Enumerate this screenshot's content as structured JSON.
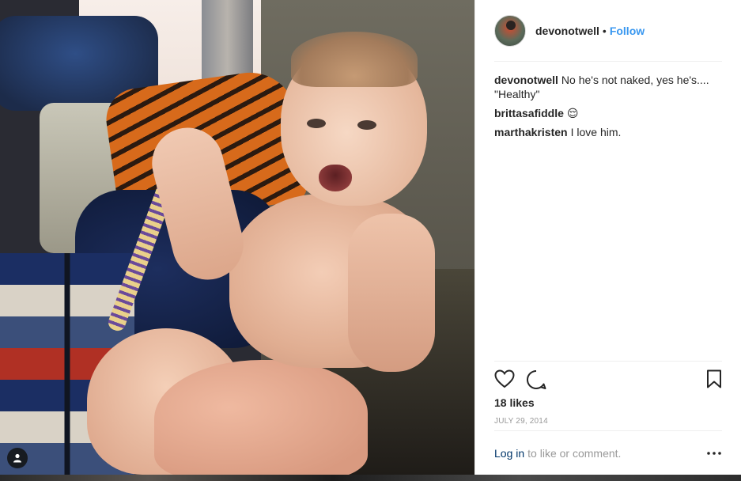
{
  "post": {
    "username": "devonotwell",
    "separator": "•",
    "follow_label": "Follow",
    "likes": "18 likes",
    "date": "JULY 29, 2014"
  },
  "comments": [
    {
      "user": "devonotwell",
      "text": "No he's not naked, yes he's.... \"Healthy\""
    },
    {
      "user": "brittasafiddle",
      "text": "😌"
    },
    {
      "user": "marthakristen",
      "text": "I love him."
    }
  ],
  "footer": {
    "login_label": "Log in",
    "rest_text": "to like or comment."
  },
  "icons": {
    "like": "heart-icon",
    "comment": "comment-bubble-icon",
    "save": "bookmark-icon",
    "more": "more-options-icon",
    "tagged": "user-tag-icon"
  },
  "colors": {
    "follow": "#3897f0",
    "login": "#003569",
    "muted": "#999999",
    "text": "#262626"
  }
}
